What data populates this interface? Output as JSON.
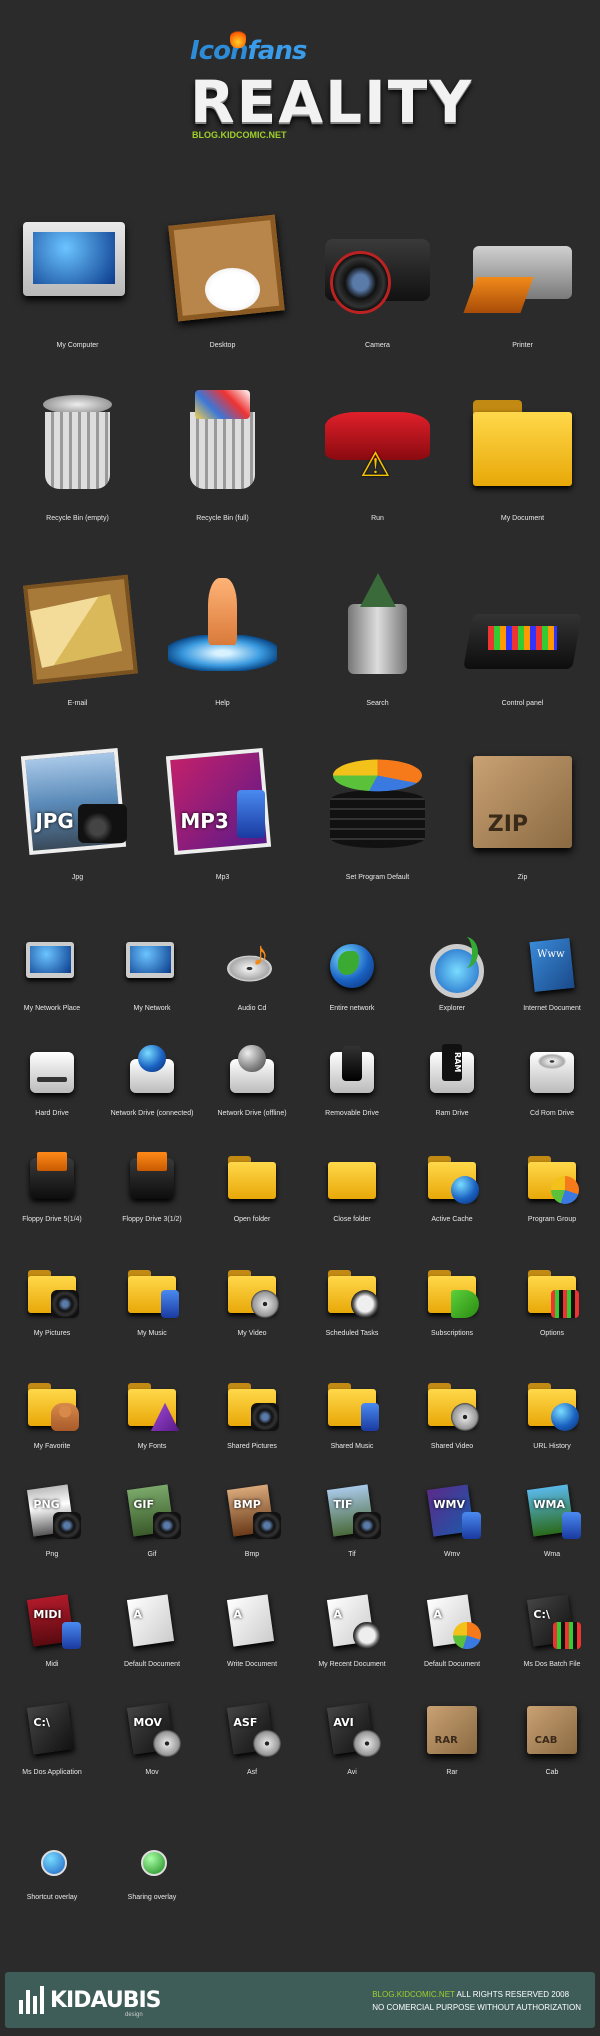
{
  "header": {
    "logo_icon": "Icon",
    "logo_fans": "fans",
    "title": "REALITY",
    "blog": "BLOG.KIDCOMIC.NET"
  },
  "big_icons": [
    {
      "label": "My Computer",
      "icon": "computer-icon"
    },
    {
      "label": "Desktop",
      "icon": "desktop-icon"
    },
    {
      "label": "Camera",
      "icon": "camera-icon"
    },
    {
      "label": "Printer",
      "icon": "printer-icon"
    },
    {
      "label": "Recycle Bin (empty)",
      "icon": "recycle-bin-empty-icon"
    },
    {
      "label": "Recycle Bin (full)",
      "icon": "recycle-bin-full-icon"
    },
    {
      "label": "Run",
      "icon": "run-icon"
    },
    {
      "label": "My Document",
      "icon": "my-document-icon"
    },
    {
      "label": "E-mail",
      "icon": "email-icon"
    },
    {
      "label": "Help",
      "icon": "help-icon"
    },
    {
      "label": "Search",
      "icon": "search-icon"
    },
    {
      "label": "Control panel",
      "icon": "control-panel-icon"
    },
    {
      "label": "Jpg",
      "icon": "jpg-icon",
      "tag": "JPG"
    },
    {
      "label": "Mp3",
      "icon": "mp3-icon",
      "tag": "MP3"
    },
    {
      "label": "Set Program Default",
      "icon": "set-program-default-icon"
    },
    {
      "label": "Zip",
      "icon": "zip-icon",
      "tag": "ZIP"
    }
  ],
  "small_icons": [
    {
      "label": "My Network Place",
      "icon": "network-place-icon"
    },
    {
      "label": "My Network",
      "icon": "my-network-icon"
    },
    {
      "label": "Audio Cd",
      "icon": "audio-cd-icon"
    },
    {
      "label": "Entire network",
      "icon": "entire-network-icon"
    },
    {
      "label": "Explorer",
      "icon": "explorer-icon"
    },
    {
      "label": "Internet Document",
      "icon": "internet-document-icon"
    },
    {
      "label": "Hard Drive",
      "icon": "hard-drive-icon"
    },
    {
      "label": "Network Drive (connected)",
      "icon": "network-drive-connected-icon"
    },
    {
      "label": "Network Drive (offline)",
      "icon": "network-drive-offline-icon"
    },
    {
      "label": "Removable Drive",
      "icon": "removable-drive-icon"
    },
    {
      "label": "Ram Drive",
      "icon": "ram-drive-icon"
    },
    {
      "label": "Cd Rom Drive",
      "icon": "cd-rom-drive-icon"
    },
    {
      "label": "Floppy Drive 5(1/4)",
      "icon": "floppy-drive-5-icon"
    },
    {
      "label": "Floppy Drive 3(1/2)",
      "icon": "floppy-drive-3-icon"
    },
    {
      "label": "Open folder",
      "icon": "open-folder-icon"
    },
    {
      "label": "Close folder",
      "icon": "close-folder-icon"
    },
    {
      "label": "Active Cache",
      "icon": "active-cache-icon"
    },
    {
      "label": "Program Group",
      "icon": "program-group-icon"
    },
    {
      "label": "My Pictures",
      "icon": "my-pictures-icon"
    },
    {
      "label": "My Music",
      "icon": "my-music-icon"
    },
    {
      "label": "My Video",
      "icon": "my-video-icon"
    },
    {
      "label": "Scheduled Tasks",
      "icon": "scheduled-tasks-icon"
    },
    {
      "label": "Subscriptions",
      "icon": "subscriptions-icon"
    },
    {
      "label": "Options",
      "icon": "options-icon"
    },
    {
      "label": "My Favorite",
      "icon": "my-favorite-icon"
    },
    {
      "label": "My Fonts",
      "icon": "my-fonts-icon"
    },
    {
      "label": "Shared Pictures",
      "icon": "shared-pictures-icon"
    },
    {
      "label": "Shared Music",
      "icon": "shared-music-icon"
    },
    {
      "label": "Shared Video",
      "icon": "shared-video-icon"
    },
    {
      "label": "URL History",
      "icon": "url-history-icon"
    },
    {
      "label": "Png",
      "icon": "png-icon",
      "tag": "PNG"
    },
    {
      "label": "Gif",
      "icon": "gif-icon",
      "tag": "GIF"
    },
    {
      "label": "Bmp",
      "icon": "bmp-icon",
      "tag": "BMP"
    },
    {
      "label": "Tif",
      "icon": "tif-icon",
      "tag": "TIF"
    },
    {
      "label": "Wmv",
      "icon": "wmv-icon",
      "tag": "WMV"
    },
    {
      "label": "Wma",
      "icon": "wma-icon",
      "tag": "WMA"
    },
    {
      "label": "Midi",
      "icon": "midi-icon",
      "tag": "MIDI"
    },
    {
      "label": "Default Document",
      "icon": "default-document-icon",
      "tag": "A"
    },
    {
      "label": "Write Document",
      "icon": "write-document-icon",
      "tag": "A"
    },
    {
      "label": "My Recent Document",
      "icon": "recent-document-icon",
      "tag": "A"
    },
    {
      "label": "Default Document",
      "icon": "default-document-pie-icon",
      "tag": "A"
    },
    {
      "label": "Ms Dos Batch File",
      "icon": "ms-dos-batch-icon",
      "tag": "C:\\"
    },
    {
      "label": "Ms Dos Application",
      "icon": "ms-dos-application-icon",
      "tag": "C:\\"
    },
    {
      "label": "Mov",
      "icon": "mov-icon",
      "tag": "MOV"
    },
    {
      "label": "Asf",
      "icon": "asf-icon",
      "tag": "ASF"
    },
    {
      "label": "Avi",
      "icon": "avi-icon",
      "tag": "AVI"
    },
    {
      "label": "Rar",
      "icon": "rar-icon",
      "tag": "RAR"
    },
    {
      "label": "Cab",
      "icon": "cab-icon",
      "tag": "CAB"
    }
  ],
  "overlays": [
    {
      "label": "Shortcut overlay",
      "icon": "shortcut-overlay-icon"
    },
    {
      "label": "Sharing overlay",
      "icon": "sharing-overlay-icon"
    }
  ],
  "footer": {
    "brand": "KIDAUBIS",
    "brand_sub": "design",
    "line1_link": "BLOG.KIDCOMIC.NET",
    "line1_rest": " ALL RIGHTS RESERVED 2008",
    "line2": "NO COMERCIAL PURPOSE WITHOUT AUTHORIZATION"
  },
  "colors": {
    "background": "#2b2b2b",
    "accent_green": "#9fd02b",
    "footer_bg": "#3e5c58"
  }
}
